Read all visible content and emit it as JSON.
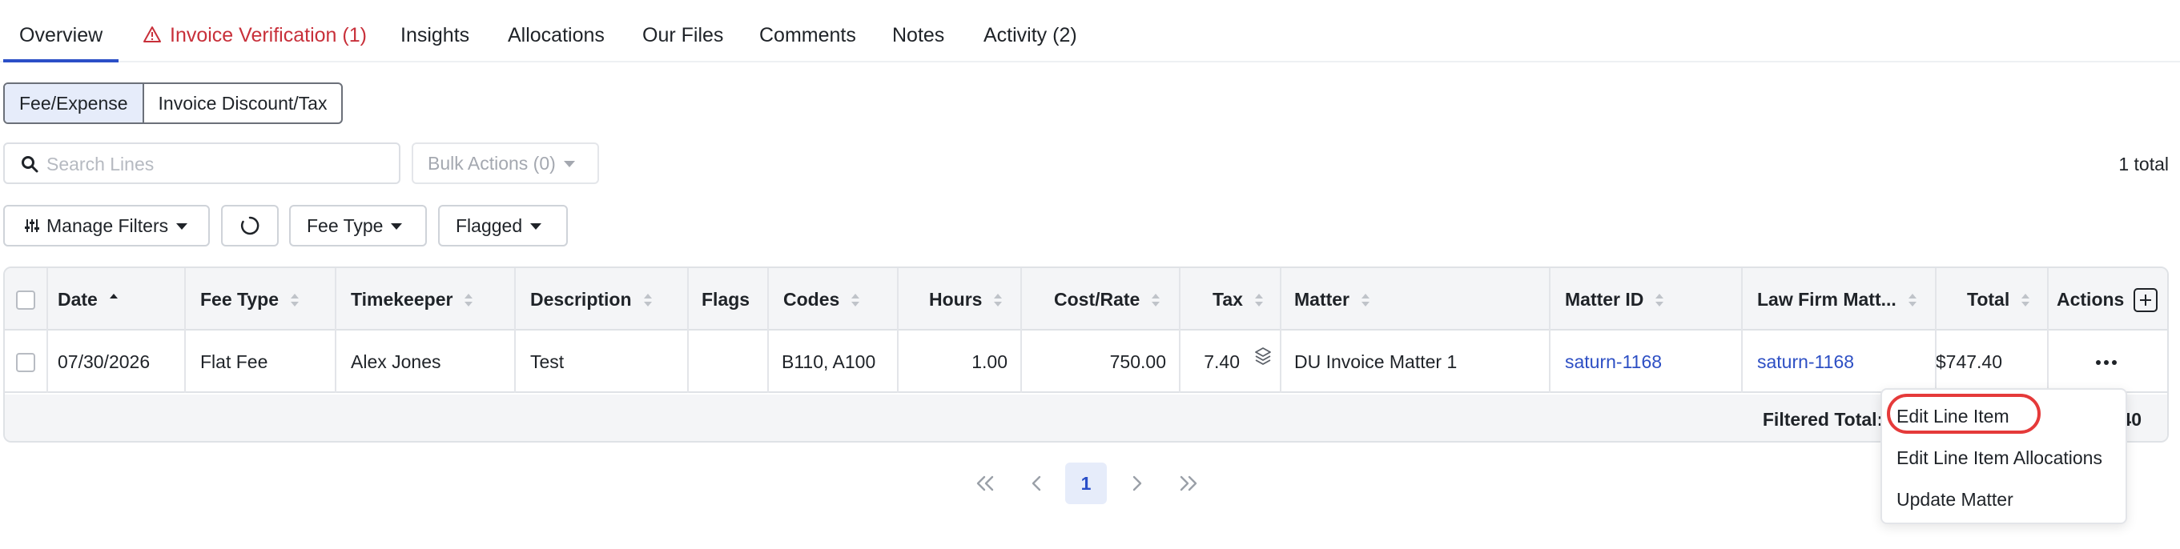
{
  "tabs": [
    {
      "label": "Overview"
    },
    {
      "label": "Invoice Verification (1)"
    },
    {
      "label": "Insights"
    },
    {
      "label": "Allocations"
    },
    {
      "label": "Our Files"
    },
    {
      "label": "Comments"
    },
    {
      "label": "Notes"
    },
    {
      "label": "Activity (2)"
    }
  ],
  "segments": {
    "fee_expense": "Fee/Expense",
    "discount_tax": "Invoice Discount/Tax"
  },
  "search": {
    "placeholder": "Search Lines",
    "value": ""
  },
  "bulk_actions": "Bulk Actions (0)",
  "total_count": "1 total",
  "filters": {
    "manage": "Manage Filters",
    "fee_type": "Fee Type",
    "flagged": "Flagged"
  },
  "table": {
    "headers": {
      "date": "Date",
      "fee_type": "Fee Type",
      "timekeeper": "Timekeeper",
      "description": "Description",
      "flags": "Flags",
      "codes": "Codes",
      "hours": "Hours",
      "cost_rate": "Cost/Rate",
      "tax": "Tax",
      "matter": "Matter",
      "matter_id": "Matter ID",
      "law_firm_matter": "Law Firm Matt...",
      "total": "Total",
      "actions": "Actions"
    },
    "rows": [
      {
        "date": "07/30/2026",
        "fee_type": "Flat Fee",
        "timekeeper": "Alex Jones",
        "description": "Test",
        "flags": "",
        "codes": "B110, A100",
        "hours": "1.00",
        "cost_rate": "750.00",
        "tax": "7.40",
        "matter": "DU Invoice Matter 1",
        "matter_id": "saturn-1168",
        "law_firm_matter": "saturn-1168",
        "total": "$747.40"
      }
    ],
    "filtered_total_label": "Filtered Total: $74",
    "filtered_total_tail": "40"
  },
  "pagination": {
    "first": "«",
    "prev": "‹",
    "current": "1",
    "next": "›",
    "last": "»"
  },
  "menu": {
    "items": [
      {
        "label": "Edit Line Item"
      },
      {
        "label": "Edit Line Item Allocations"
      },
      {
        "label": "Update Matter"
      }
    ]
  },
  "colors": {
    "accent": "#2b4fc7",
    "link": "#2d4fc4",
    "warning": "#c8303a",
    "highlight": "#e53a3a"
  }
}
